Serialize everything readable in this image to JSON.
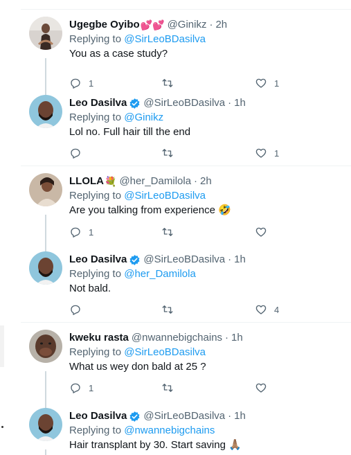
{
  "tweets": [
    {
      "name": "Ugegbe Oyibo",
      "name_emoji": "💕💕",
      "handle": "@Ginikz",
      "time": "2h",
      "verified": false,
      "reply_prefix": "Replying to ",
      "reply_to": "@SirLeoBDasilva",
      "text": "You as a case study?",
      "replies": "1",
      "retweets": "",
      "likes": "1"
    },
    {
      "name": "Leo Dasilva",
      "name_emoji": "",
      "handle": "@SirLeoBDasilva",
      "time": "1h",
      "verified": true,
      "reply_prefix": "Replying to ",
      "reply_to": "@Ginikz",
      "text": "Lol no. Full hair till the end",
      "replies": "",
      "retweets": "",
      "likes": "1"
    },
    {
      "name": "LLOLA",
      "name_emoji": "💐",
      "handle": "@her_Damilola",
      "time": "2h",
      "verified": false,
      "reply_prefix": "Replying to ",
      "reply_to": "@SirLeoBDasilva",
      "text": "Are you talking from experience 🤣",
      "replies": "1",
      "retweets": "",
      "likes": ""
    },
    {
      "name": "Leo Dasilva",
      "name_emoji": "",
      "handle": "@SirLeoBDasilva",
      "time": "1h",
      "verified": true,
      "reply_prefix": "Replying to ",
      "reply_to": "@her_Damilola",
      "text": "Not bald.",
      "replies": "",
      "retweets": "",
      "likes": "4"
    },
    {
      "name": "kweku rasta",
      "name_emoji": "",
      "handle": "@nwannebigchains",
      "time": "1h",
      "verified": false,
      "reply_prefix": "Replying to ",
      "reply_to": "@SirLeoBDasilva",
      "text": "What us wey don bald at 25 ?",
      "replies": "1",
      "retweets": "",
      "likes": ""
    },
    {
      "name": "Leo Dasilva",
      "name_emoji": "",
      "handle": "@SirLeoBDasilva",
      "time": "1h",
      "verified": true,
      "reply_prefix": "Replying to ",
      "reply_to": "@nwannebigchains",
      "text": "Hair transplant by 30. Start saving 🙏🏽",
      "replies": "",
      "retweets": "",
      "likes": ""
    }
  ],
  "separator": "·",
  "colors": {
    "accent": "#1d9bf0",
    "secondary_text": "#536471",
    "primary_text": "#0f1419",
    "divider": "#eff3f4",
    "thread_line": "#cfd9de"
  },
  "icons": {
    "reply": "reply-icon",
    "retweet": "retweet-icon",
    "like": "heart-icon",
    "verified": "verified-badge-icon"
  }
}
